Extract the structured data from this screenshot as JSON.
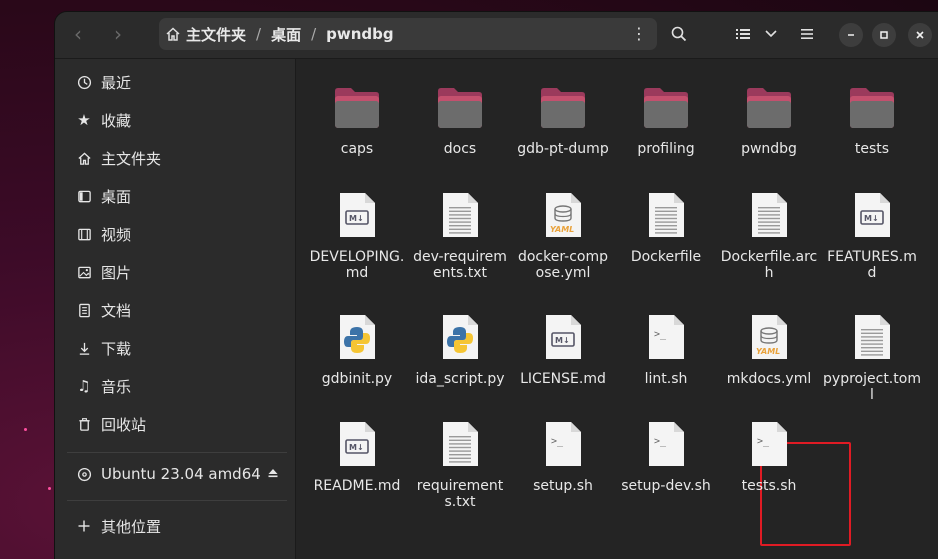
{
  "header": {
    "breadcrumb": {
      "home": "主文件夹",
      "sep1": "/",
      "desktop": "桌面",
      "sep2": "/",
      "current": "pwndbg"
    }
  },
  "sidebar": {
    "items": [
      {
        "label": "最近",
        "icon": "clock-icon"
      },
      {
        "label": "收藏",
        "icon": "star-icon"
      },
      {
        "label": "主文件夹",
        "icon": "home-icon"
      },
      {
        "label": "桌面",
        "icon": "desktop-icon"
      },
      {
        "label": "视频",
        "icon": "video-icon"
      },
      {
        "label": "图片",
        "icon": "image-icon"
      },
      {
        "label": "文档",
        "icon": "document-icon"
      },
      {
        "label": "下载",
        "icon": "download-icon"
      },
      {
        "label": "音乐",
        "icon": "music-icon"
      },
      {
        "label": "回收站",
        "icon": "trash-icon"
      }
    ],
    "drive": {
      "label": "Ubuntu 23.04 amd64",
      "icon": "disc-icon"
    },
    "other": {
      "label": "其他位置",
      "icon": "plus-icon"
    }
  },
  "files": [
    {
      "name": "caps",
      "type": "folder"
    },
    {
      "name": "docs",
      "type": "folder"
    },
    {
      "name": "gdb-pt-dump",
      "type": "folder"
    },
    {
      "name": "profiling",
      "type": "folder"
    },
    {
      "name": "pwndbg",
      "type": "folder"
    },
    {
      "name": "tests",
      "type": "folder"
    },
    {
      "name": "DEVELOPING.md",
      "type": "markdown"
    },
    {
      "name": "dev-requirements.txt",
      "type": "text"
    },
    {
      "name": "docker-compose.yml",
      "type": "yaml"
    },
    {
      "name": "Dockerfile",
      "type": "text"
    },
    {
      "name": "Dockerfile.arch",
      "type": "text"
    },
    {
      "name": "FEATURES.md",
      "type": "markdown"
    },
    {
      "name": "gdbinit.py",
      "type": "python"
    },
    {
      "name": "ida_script.py",
      "type": "python"
    },
    {
      "name": "LICENSE.md",
      "type": "markdown"
    },
    {
      "name": "lint.sh",
      "type": "shell"
    },
    {
      "name": "mkdocs.yml",
      "type": "yaml"
    },
    {
      "name": "pyproject.toml",
      "type": "text"
    },
    {
      "name": "README.md",
      "type": "markdown"
    },
    {
      "name": "requirements.txt",
      "type": "text"
    },
    {
      "name": "setup.sh",
      "type": "shell",
      "highlighted": true
    },
    {
      "name": "setup-dev.sh",
      "type": "shell"
    },
    {
      "name": "tests.sh",
      "type": "shell"
    }
  ],
  "colors": {
    "folder": "#9b3a5c",
    "folder_tab": "#c4506e",
    "highlight": "#e01b24",
    "yaml_badge": "#e9a23b"
  }
}
